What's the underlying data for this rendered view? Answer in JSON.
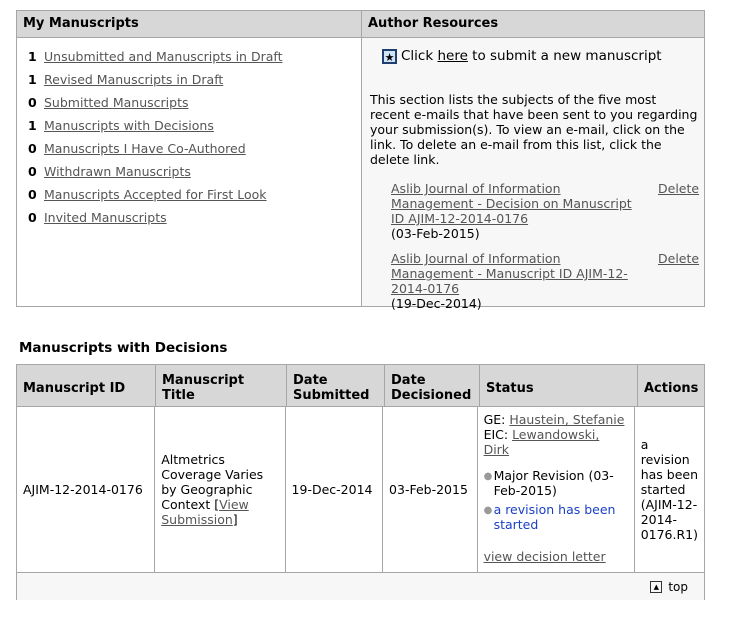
{
  "my_manuscripts": {
    "title": "My Manuscripts",
    "items": [
      {
        "count": "1",
        "label": "Unsubmitted and Manuscripts in Draft"
      },
      {
        "count": "1",
        "label": "Revised Manuscripts in Draft"
      },
      {
        "count": "0",
        "label": "Submitted Manuscripts"
      },
      {
        "count": "1",
        "label": "Manuscripts with Decisions"
      },
      {
        "count": "0",
        "label": "Manuscripts I Have Co-Authored"
      },
      {
        "count": "0",
        "label": "Withdrawn Manuscripts"
      },
      {
        "count": "0",
        "label": "Manuscripts Accepted for First Look"
      },
      {
        "count": "0",
        "label": "Invited Manuscripts"
      }
    ]
  },
  "author_resources": {
    "title": "Author Resources",
    "submit_prefix": "Click ",
    "submit_link": "here",
    "submit_suffix": " to submit a new manuscript",
    "description": "This section lists the subjects of the five most recent e-mails that have been sent to you regarding your submission(s). To view an e-mail, click on the link. To delete an e-mail from this list, click the delete link.",
    "emails": [
      {
        "subject": "Aslib Journal of Information Management - Decision on Manuscript ID AJIM-12-2014-0176",
        "date": "(03-Feb-2015)",
        "delete": "Delete"
      },
      {
        "subject": "Aslib Journal of Information Management - Manuscript ID AJIM-12-2014-0176",
        "date": "(19-Dec-2014)",
        "delete": "Delete"
      }
    ]
  },
  "decisions": {
    "section_title": "Manuscripts with Decisions",
    "headers": {
      "id": "Manuscript ID",
      "title": "Manuscript Title",
      "submitted": "Date Submitted",
      "decisioned": "Date Decisioned",
      "status": "Status",
      "actions": "Actions"
    },
    "row": {
      "id": "AJIM-12-2014-0176",
      "title": "Altmetrics Coverage Varies by Geographic Context",
      "view_open": " [",
      "view_link": "View Submission",
      "view_close": "]",
      "submitted": "19-Dec-2014",
      "decisioned": "03-Feb-2015",
      "ge_label": "GE: ",
      "ge_name": "Haustein, Stefanie",
      "eic_label": "EIC: ",
      "eic_name": "Lewandowski, Dirk",
      "status_major": "Major Revision (03-Feb-2015)",
      "status_revision": "a revision has been started",
      "decision_letter": "view decision letter",
      "actions": "a revision has been started (AJIM-12-2014-0176.R1)"
    },
    "top_link": "top"
  }
}
